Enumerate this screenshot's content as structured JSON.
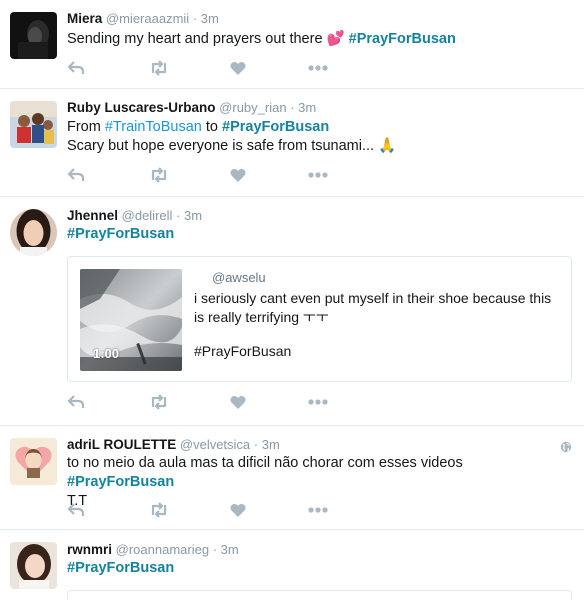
{
  "tweets": [
    {
      "name": "Miera",
      "handle": "@mieraaazmii",
      "dot": "·",
      "time": "3m",
      "text": "Sending my heart and prayers out there ",
      "emoji": "💕",
      "hashtag": "#PrayForBusan"
    },
    {
      "name": "Ruby Luscares-Urbano",
      "handle": "@ruby_rian",
      "dot": "·",
      "time": "3m",
      "line1_from": "From ",
      "line1_tag1": "#TrainToBusan",
      "line1_to": " to ",
      "line1_tag2": "#PrayForBusan",
      "line2": "Scary but hope everyone is safe from tsunami... ",
      "emoji": "🙏"
    },
    {
      "name": "Jhennel",
      "handle": "@delirell",
      "dot": "·",
      "time": "3m",
      "hashtag": "#PrayForBusan",
      "card": {
        "handle": "@awselu",
        "text": "i seriously cant even put myself in their shoe because this is really terrifying ㅜㅜ",
        "hashtag": "#PrayForBusan",
        "duration": "1:00"
      }
    },
    {
      "name": "adriL ROULETTE",
      "handle": "@velvetsica",
      "dot": "·",
      "time": "3m",
      "text": "to no meio da aula mas ta dificil não chorar com esses videos ",
      "hashtag": "#PrayForBusan",
      "line2": "T.T"
    },
    {
      "name": "rwnmri",
      "handle": "@roannamarieg",
      "dot": "·",
      "time": "3m",
      "hashtag": "#PrayForBusan"
    }
  ],
  "icons": {
    "reply": "reply-icon",
    "retweet": "retweet-icon",
    "like": "heart-icon",
    "more": "more-icon",
    "globe": "globe-icon"
  },
  "colors": {
    "hashtag": "#1b95e0",
    "muted": "#8899a6",
    "icon": "#aab8c2",
    "border": "#e6ecf0"
  }
}
